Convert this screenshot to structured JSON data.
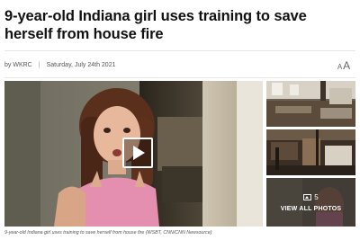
{
  "article": {
    "headline": "9-year-old Indiana girl uses training to save herself from house fire",
    "byline": "by WKRC",
    "date": "Saturday, July 24th 2021",
    "font_size_control": {
      "small": "A",
      "large": "A"
    }
  },
  "media": {
    "play_icon": "play-icon",
    "gallery": {
      "count": "5",
      "view_all_label": "VIEW ALL PHOTOS",
      "icon": "image-icon"
    },
    "caption": "9-year-old Indiana girl uses training to save herself from house fire (WSBT, CNN/CNN Newsource)"
  },
  "colors": {
    "text": "#111111",
    "meta": "#555555",
    "rule": "#e6e6e6",
    "overlay": "#141414"
  }
}
